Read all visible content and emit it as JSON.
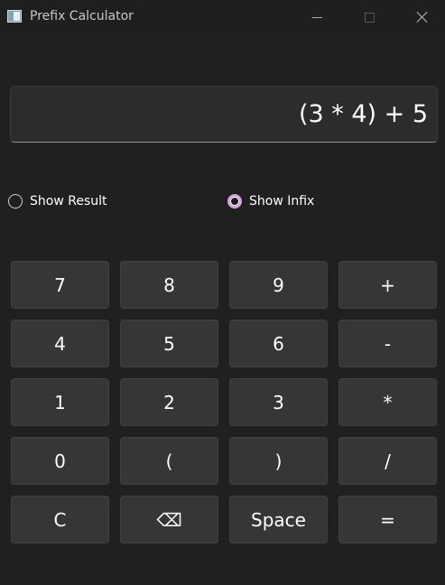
{
  "window": {
    "title": "Prefix Calculator"
  },
  "display": {
    "expression": "(3 * 4) + 5"
  },
  "options": {
    "show_result_label": "Show Result",
    "show_result_selected": false,
    "show_infix_label": "Show Infix",
    "show_infix_selected": true,
    "accent_color": "#d6a3e0"
  },
  "keypad": {
    "keys": [
      "7",
      "8",
      "9",
      "+",
      "4",
      "5",
      "6",
      "-",
      "1",
      "2",
      "3",
      "*",
      "0",
      "(",
      ")",
      "/",
      "C",
      "⌫",
      "Space",
      "="
    ]
  },
  "colors": {
    "background": "#202020",
    "button": "#363636",
    "display": "#2c2c2c"
  }
}
